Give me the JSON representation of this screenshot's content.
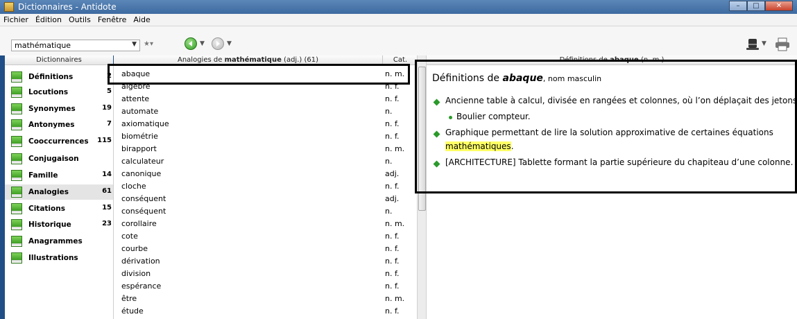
{
  "window": {
    "title": "Dictionnaires - Antidote",
    "minimize": "–",
    "maximize": "□",
    "close": "✕"
  },
  "menu": [
    "Fichier",
    "Édition",
    "Outils",
    "Fenêtre",
    "Aide"
  ],
  "toolbar": {
    "search_value": "mathématique",
    "icons": [
      "dropdown-icon",
      "star-icon",
      "back-icon",
      "forward-icon",
      "hat-icon",
      "print-icon"
    ]
  },
  "headers": {
    "dictionaries": "Dictionnaires",
    "analogies_prefix": "Analogies de ",
    "analogies_word": "mathématique",
    "analogies_suffix": " (adj.) (61)",
    "cat": "Cat.",
    "definitions_prefix": "Définitions de ",
    "definitions_word": "abaque",
    "definitions_suffix": " (n. m.)"
  },
  "dictionaries": [
    {
      "label": "Définitions",
      "count": "2"
    },
    {
      "label": "Locutions",
      "count": "5"
    },
    {
      "label": "Synonymes",
      "count": "19"
    },
    {
      "label": "Antonymes",
      "count": "7"
    },
    {
      "label": "Cooccurrences",
      "count": "115"
    },
    {
      "label": "Conjugaison",
      "count": ""
    },
    {
      "label": "Famille",
      "count": "14"
    },
    {
      "label": "Analogies",
      "count": "61"
    },
    {
      "label": "Citations",
      "count": "15"
    },
    {
      "label": "Historique",
      "count": "23"
    },
    {
      "label": "Anagrammes",
      "count": ""
    },
    {
      "label": "Illustrations",
      "count": ""
    }
  ],
  "words": [
    {
      "w": "abaque",
      "c": "n. m."
    },
    {
      "w": "algèbre",
      "c": "n. f."
    },
    {
      "w": "attente",
      "c": "n. f."
    },
    {
      "w": "automate",
      "c": "n."
    },
    {
      "w": "axiomatique",
      "c": "n. f."
    },
    {
      "w": "biométrie",
      "c": "n. f."
    },
    {
      "w": "birapport",
      "c": "n. m."
    },
    {
      "w": "calculateur",
      "c": "n."
    },
    {
      "w": "canonique",
      "c": "adj."
    },
    {
      "w": "cloche",
      "c": "n. f."
    },
    {
      "w": "conséquent",
      "c": "adj."
    },
    {
      "w": "conséquent",
      "c": "n."
    },
    {
      "w": "corollaire",
      "c": "n. m."
    },
    {
      "w": "cote",
      "c": "n. f."
    },
    {
      "w": "courbe",
      "c": "n. f."
    },
    {
      "w": "dérivation",
      "c": "n. f."
    },
    {
      "w": "division",
      "c": "n. f."
    },
    {
      "w": "espérance",
      "c": "n. f."
    },
    {
      "w": "être",
      "c": "n. m."
    },
    {
      "w": "étude",
      "c": "n. f."
    }
  ],
  "definition": {
    "title_prefix": "Définitions de ",
    "title_word": "abaque",
    "title_suffix": ", nom masculin",
    "def1": "Ancienne table à calcul, divisée en rangées et colonnes, où l’on déplaçait des jetons.",
    "sub1": "Boulier compteur.",
    "def2_line1": "Graphique permettant de lire la solution approximative de certaines équations",
    "def2_hl": "mathématiques",
    "def2_end": ".",
    "def3": "[ARCHITECTURE] Tablette formant la partie supérieure du chapiteau d’une colonne."
  },
  "colors": {
    "accent_green": "#2a9a2a",
    "highlight": "#ffff66",
    "title_bar": "#3d6aa0"
  }
}
